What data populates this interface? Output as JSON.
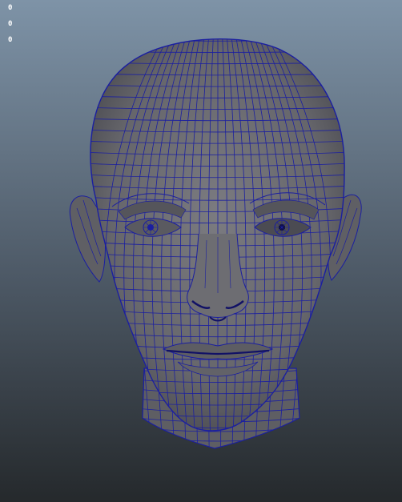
{
  "viewport": {
    "background_top": "#7e93a7",
    "background_bottom": "#25292c",
    "mesh_fill": "#6b6b6f",
    "wire_color": "#1b1fa0"
  },
  "hud": {
    "readouts": [
      "0",
      "0",
      "0"
    ]
  },
  "model": {
    "icon": "head-wireframe-icon"
  }
}
